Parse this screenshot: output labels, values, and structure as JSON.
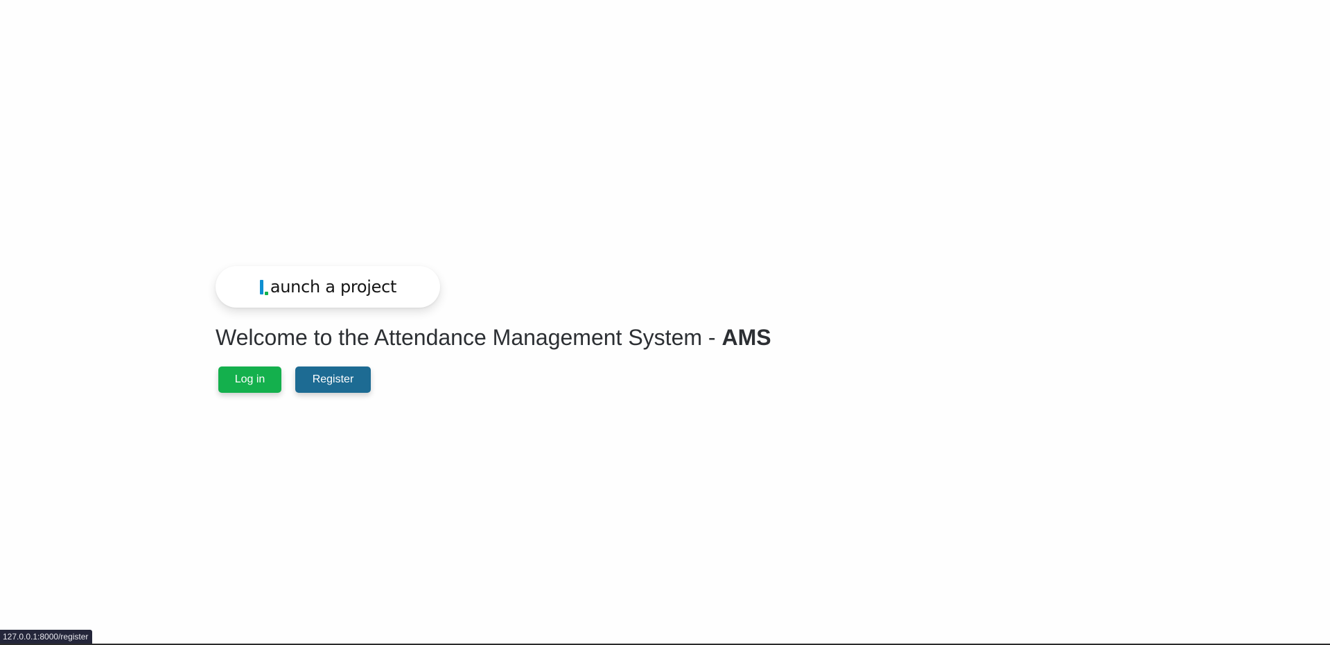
{
  "logo": {
    "text": "aunch a project",
    "icon": "launch-logo-icon",
    "colors": {
      "stem": "#0e8fd1",
      "dot": "#12b24d"
    }
  },
  "hero": {
    "title_prefix": "Welcome to the Attendance Management System - ",
    "title_strong": "AMS"
  },
  "actions": {
    "login_label": "Log in",
    "register_label": "Register",
    "colors": {
      "login": "#14b04d",
      "register": "#1d6b93"
    }
  },
  "status_bar": {
    "url": "127.0.0.1:8000/register"
  }
}
